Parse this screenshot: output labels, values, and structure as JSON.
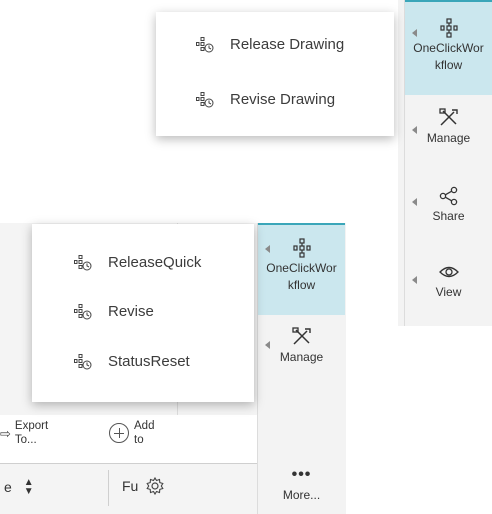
{
  "top_menu": {
    "items": [
      {
        "label": "Release Drawing"
      },
      {
        "label": "Revise Drawing"
      }
    ]
  },
  "top_rail": {
    "buttons": [
      {
        "label": "OneClickWorkflow",
        "icon": "workflow-icon",
        "active": true
      },
      {
        "label": "Manage",
        "icon": "tools-icon"
      },
      {
        "label": "Share",
        "icon": "share-icon"
      },
      {
        "label": "View",
        "icon": "eye-icon"
      }
    ]
  },
  "bottom_menu": {
    "items": [
      {
        "label": "ReleaseQuick"
      },
      {
        "label": "Revise"
      },
      {
        "label": "StatusReset"
      }
    ]
  },
  "bottom_rail": {
    "buttons": [
      {
        "label": "OneClickWorkflow",
        "icon": "workflow-icon",
        "active": true
      },
      {
        "label": "Manage",
        "icon": "tools-icon"
      },
      {
        "label": "More...",
        "icon": "more-icon"
      }
    ]
  },
  "toolbar": {
    "export_label_1": "Export",
    "export_label_2": "To...",
    "add_label_1": "Add",
    "add_label_2": "to"
  },
  "table": {
    "col1_fragment": "e",
    "col2_fragment": "Fu"
  },
  "colors": {
    "accent": "#3aa6b9",
    "active_bg": "#cbe7ee",
    "rail_bg": "#f3f3f3"
  }
}
